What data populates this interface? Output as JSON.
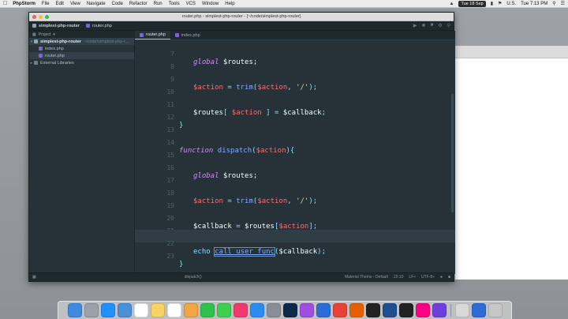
{
  "menubar": {
    "apple": "",
    "items": [
      "PhpStorm",
      "File",
      "Edit",
      "View",
      "Navigate",
      "Code",
      "Refactor",
      "Run",
      "Tools",
      "VCS",
      "Window",
      "Help"
    ],
    "date": "Tue 18 Sep",
    "region": "U.S.",
    "time": "Tue 7:13 PM"
  },
  "window": {
    "title": "router.php - simplest-php-router - [~/code/simplest-php-router]"
  },
  "toolbar": {
    "project": "simplest-php-router",
    "file": "router.php"
  },
  "project_panel": {
    "header": "Project",
    "root": {
      "name": "simplest-php-router",
      "path": "~/code/simplest-php-r..."
    },
    "files": [
      "index.php",
      "router.php"
    ],
    "external": "External Libraries"
  },
  "tabs": [
    {
      "label": "router.php",
      "active": true
    },
    {
      "label": "index.php",
      "active": false
    }
  ],
  "code": {
    "line_numbers": [
      "7",
      "8",
      "9",
      "10",
      "11",
      "12",
      "13",
      "14",
      "15",
      "16",
      "17",
      "18",
      "19",
      "20",
      "21",
      "22",
      "23"
    ],
    "l7": {
      "kw": "global",
      "var": "$routes",
      "end": ";"
    },
    "l9": {
      "var": "$action",
      "eq": " = ",
      "fn": "trim",
      "open": "(",
      "arg": "$action",
      "sep": ", ",
      "str": "'/'",
      "close": ");"
    },
    "l11": {
      "var": "$routes",
      "open": "[ ",
      "key": "$action",
      "mid": " ] = ",
      "val": "$callback",
      "end": ";"
    },
    "l12": {
      "brace": "}"
    },
    "l14": {
      "kw": "function",
      "fn": "dispatch",
      "open": "(",
      "arg": "$action",
      "close": "){"
    },
    "l16": {
      "kw": "global",
      "var": "$routes",
      "end": ";"
    },
    "l18": {
      "var": "$action",
      "eq": " = ",
      "fn": "trim",
      "open": "(",
      "arg": "$action",
      "sep": ", ",
      "str": "'/'",
      "close": ");"
    },
    "l20": {
      "var": "$callback",
      "eq": " = ",
      "var2": "$routes",
      "open": "[",
      "key": "$action",
      "end": "];"
    },
    "l22": {
      "kw": "echo",
      "fn": "call_user_func",
      "open": "(",
      "arg": "$callback",
      "close": ");"
    },
    "l23": {
      "brace": "}"
    }
  },
  "statusbar": {
    "crumb": "dispatch()",
    "theme": "Material Theme - Default",
    "position": "22:10",
    "line_sep": "LF÷",
    "encoding": "UTF-8÷"
  },
  "dock": {
    "icons": [
      "finder-icon",
      "launchpad-icon",
      "safari-icon",
      "mail-icon",
      "calendar-icon",
      "notes-icon",
      "reminders-icon",
      "photos-icon",
      "facetime-icon",
      "messages-icon",
      "itunes-icon",
      "appstore-icon",
      "preferences-icon",
      "photoshop-icon",
      "phpstorm-icon",
      "vscode-icon",
      "chrome-icon",
      "firefox-icon",
      "terminal-icon",
      "sourcetree-icon",
      "react-icon",
      "flickr-icon",
      "insomnia-icon",
      "downloads-icon",
      "vscode-stack-icon",
      "trash-icon"
    ],
    "colors": [
      "#3c8bde",
      "#9aa1ab",
      "#1e90ff",
      "#4a90d9",
      "#ffffff",
      "#f6d365",
      "#ffffff",
      "#f2a541",
      "#2ec24a",
      "#3fcf4f",
      "#f03c6c",
      "#2a8cf0",
      "#8a8f97",
      "#0b2a4a",
      "#a14ee0",
      "#2b6cd6",
      "#e94235",
      "#e66000",
      "#222222",
      "#1d4f91",
      "#222222",
      "#ff0084",
      "#6f3fdd",
      "#d8d8d8",
      "#2b6cd6",
      "#c7c7c7"
    ]
  }
}
